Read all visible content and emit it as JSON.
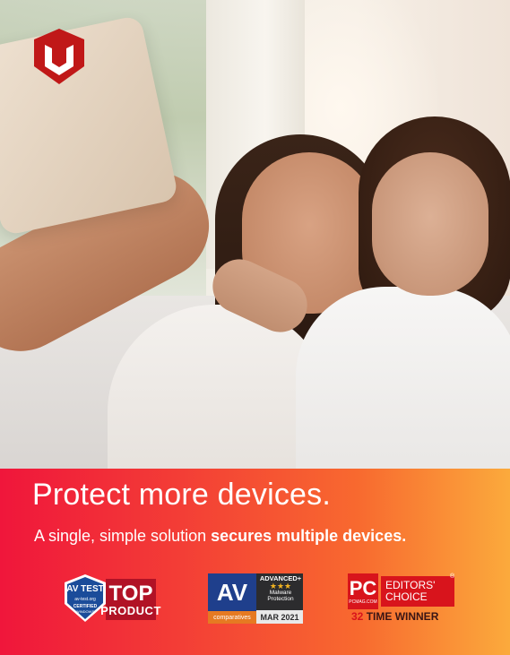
{
  "brand": {
    "logo_icon": "mcafee-shield-icon",
    "logo_color": "#c01818"
  },
  "banner": {
    "headline": "Protect more devices.",
    "subline_regular": "A single, simple solution ",
    "subline_bold": "secures multiple devices.",
    "gradient_colors": [
      "#f0163b",
      "#f8692f",
      "#fbaa3c"
    ]
  },
  "badges": {
    "avtest": {
      "logo": "AV TEST",
      "site": "av-test.org",
      "certified": "CERTIFIED",
      "platform": "WINDOWS",
      "top": "TOP",
      "product": "PRODUCT"
    },
    "avcomparatives": {
      "av": "AV",
      "comparatives": "comparatives",
      "level": "ADVANCED+",
      "stars": "★★★",
      "category": "Malware Protection",
      "date": "MAR 2021"
    },
    "pcmag": {
      "pc": "PC",
      "pcmag_com": "PCMAG.COM",
      "editors": "EDITORS'",
      "choice": "CHOICE",
      "registered": "®",
      "count": "32",
      "winner": " TIME WINNER"
    }
  }
}
